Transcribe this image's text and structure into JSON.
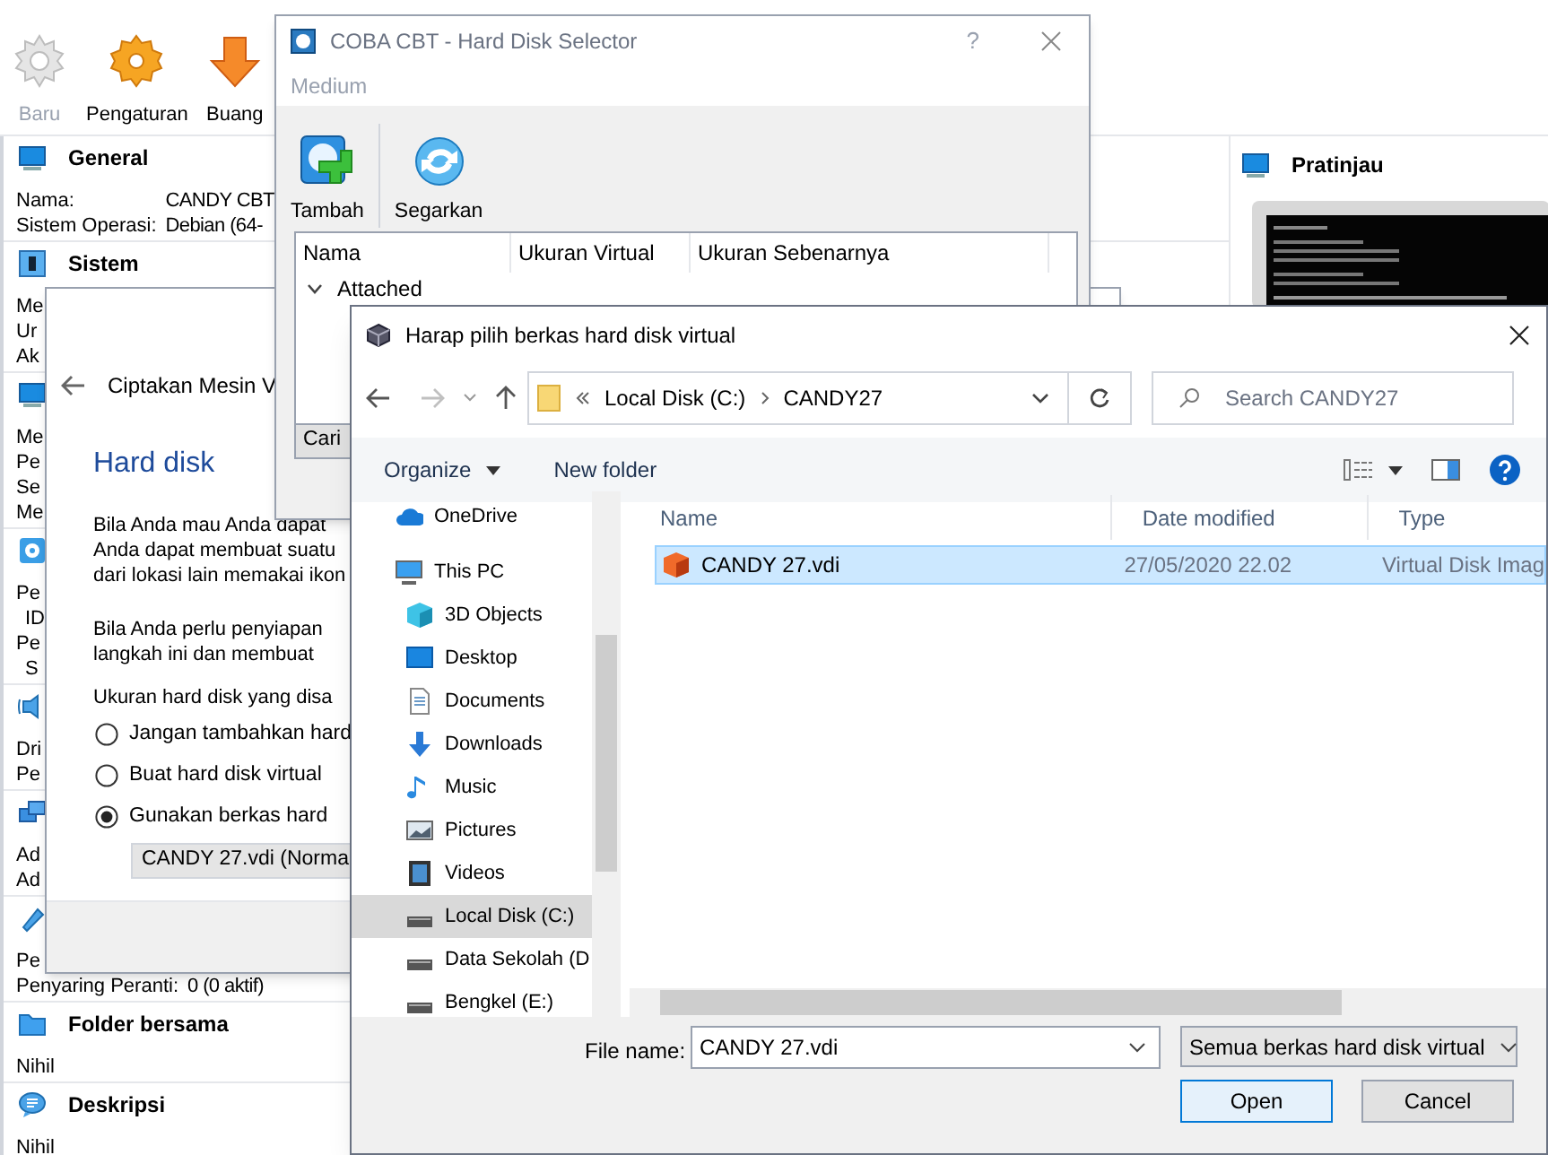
{
  "main_window": {
    "toolbar": [
      {
        "label": "Baru",
        "kind": "new",
        "disabled": true
      },
      {
        "label": "Pengaturan",
        "kind": "settings",
        "disabled": false
      },
      {
        "label": "Buang",
        "kind": "discard",
        "disabled": false
      }
    ],
    "sections": [
      {
        "kind": "general",
        "title": "General",
        "rows": [
          {
            "label": "Nama:",
            "value": "CANDY CBT"
          },
          {
            "label": "Sistem Operasi:",
            "value": "Debian (64-"
          }
        ]
      },
      {
        "kind": "system",
        "title": "Sistem",
        "rows": [
          {
            "label": "Me"
          },
          {
            "label": "Ur"
          },
          {
            "label": "Ak"
          }
        ]
      },
      {
        "kind": "display",
        "rows": [
          {
            "label": "Me"
          },
          {
            "label": "Pe"
          },
          {
            "label": "Se"
          },
          {
            "label": "Me"
          }
        ]
      },
      {
        "kind": "storage",
        "rows": [
          {
            "label": "Pe",
            "sub": false
          },
          {
            "label": "ID",
            "sub": true
          },
          {
            "label": "Pe",
            "sub": false
          },
          {
            "label": "S",
            "sub": true
          }
        ]
      },
      {
        "kind": "audio",
        "rows": [
          {
            "label": "Dri"
          },
          {
            "label": "Pe"
          }
        ]
      },
      {
        "kind": "network",
        "rows": [
          {
            "label": "Ad"
          },
          {
            "label": "Ad"
          }
        ]
      },
      {
        "kind": "usb",
        "rows": [
          {
            "label": "Pe"
          },
          {
            "label": "Penyaring Peranti:",
            "value": "0 (0 aktif)"
          }
        ]
      },
      {
        "kind": "shared",
        "title": "Folder bersama",
        "rows": [
          {
            "label": "Nihil"
          }
        ]
      },
      {
        "kind": "description",
        "title": "Deskripsi",
        "rows": [
          {
            "label": "Nihil"
          }
        ]
      }
    ],
    "preview": {
      "title": "Pratinjau"
    }
  },
  "wizard": {
    "title": "Ciptakan Mesin V",
    "heading": "Hard disk",
    "paragraphs": [
      [
        "Bila Anda mau Anda dapat",
        "Anda dapat membuat suatu",
        "dari lokasi lain memakai ikon"
      ],
      [
        "Bila Anda perlu penyiapan",
        "langkah ini dan membuat"
      ],
      [
        "Ukuran hard disk yang disa"
      ]
    ],
    "options": [
      {
        "label": "Jangan tambahkan hard",
        "selected": false
      },
      {
        "label": "Buat hard disk virtual",
        "selected": false
      },
      {
        "label": "Gunakan berkas hard",
        "selected": true
      }
    ],
    "disk_combo": "CANDY 27.vdi (Norma"
  },
  "selector": {
    "title": "COBA CBT - Hard Disk Selector",
    "help": "?",
    "menu": [
      "Medium"
    ],
    "tools": [
      {
        "label": "Tambah",
        "kind": "add"
      },
      {
        "label": "Segarkan",
        "kind": "refresh"
      }
    ],
    "columns": [
      "Nama",
      "Ukuran Virtual",
      "Ukuran Sebenarnya"
    ],
    "groups": [
      {
        "label": "Attached",
        "expanded": true
      }
    ],
    "search_button": "Cari"
  },
  "file_dialog": {
    "title": "Harap pilih berkas hard disk virtual",
    "breadcrumb": [
      "Local Disk (C:)",
      "CANDY27"
    ],
    "search_placeholder": "Search CANDY27",
    "toolbar": [
      {
        "label": "Organize",
        "menu": true
      },
      {
        "label": "New folder",
        "menu": false
      }
    ],
    "nav": [
      {
        "label": "OneDrive",
        "kind": "cloud",
        "selected": false
      },
      {
        "label": "This PC",
        "kind": "pc",
        "selected": false,
        "children": [
          {
            "label": "3D Objects",
            "kind": "cube",
            "selected": false
          },
          {
            "label": "Desktop",
            "kind": "desktop",
            "selected": false
          },
          {
            "label": "Documents",
            "kind": "document",
            "selected": false
          },
          {
            "label": "Downloads",
            "kind": "download",
            "selected": false
          },
          {
            "label": "Music",
            "kind": "music",
            "selected": false
          },
          {
            "label": "Pictures",
            "kind": "pictures",
            "selected": false
          },
          {
            "label": "Videos",
            "kind": "videos",
            "selected": false
          },
          {
            "label": "Local Disk (C:)",
            "kind": "drive",
            "selected": true
          },
          {
            "label": "Data Sekolah (D",
            "kind": "drive",
            "selected": false
          },
          {
            "label": "Bengkel (E:)",
            "kind": "drive",
            "selected": false
          }
        ]
      }
    ],
    "columns": [
      "Name",
      "Date modified",
      "Type"
    ],
    "files": [
      {
        "name": "CANDY 27.vdi",
        "date": "27/05/2020 22.02",
        "type": "Virtual Disk Imag",
        "selected": true
      }
    ],
    "file_name_label": "File name:",
    "file_name": "CANDY 27.vdi",
    "filter": "Semua berkas hard disk virtual",
    "buttons": [
      {
        "label": "Open",
        "default": true
      },
      {
        "label": "Cancel",
        "default": false
      }
    ]
  }
}
